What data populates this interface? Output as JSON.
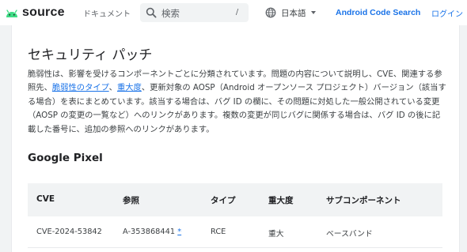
{
  "header": {
    "logo_text": "source",
    "docs_label": "ドキュメント",
    "search_placeholder": "検索",
    "search_shortcut": "/",
    "language_label": "日本語",
    "code_search_label": "Android Code Search",
    "login_label": "ログイン"
  },
  "article": {
    "title": "セキュリティ パッチ",
    "paragraph": {
      "part1": "脆弱性は、影響を受けるコンポーネントごとに分類されています。問題の内容について説明し、CVE、関連する参照先、",
      "link1": "脆弱性のタイプ",
      "sep": "、",
      "link2": "重大度",
      "part2": "、更新対象の AOSP（Android オープンソース プロジェクト）バージョン（該当する場合）を表にまとめています。該当する場合は、バグ ID の欄に、その問題に対処した一般公開されている変更（AOSP の変更の一覧など）へのリンクがあります。複数の変更が同じバグに関係する場合は、バグ ID の後に記載した番号に、追加の参照へのリンクがあります。"
    },
    "section_heading": "Google Pixel"
  },
  "table": {
    "headers": {
      "cve": "CVE",
      "reference": "参照",
      "type": "タイプ",
      "severity": "重大度",
      "subcomponent": "サブコンポーネント"
    },
    "rows": [
      {
        "cve": "CVE-2024-53842",
        "reference": "A-353868441",
        "ref_note": "*",
        "type": "RCE",
        "severity": "重大",
        "subcomponent": "ベースバンド"
      }
    ]
  },
  "colors": {
    "accent": "#1a73e8",
    "android_green": "#3ddc84"
  },
  "icons": [
    "android-logo-icon",
    "search-icon",
    "globe-icon",
    "caret-down-icon"
  ]
}
